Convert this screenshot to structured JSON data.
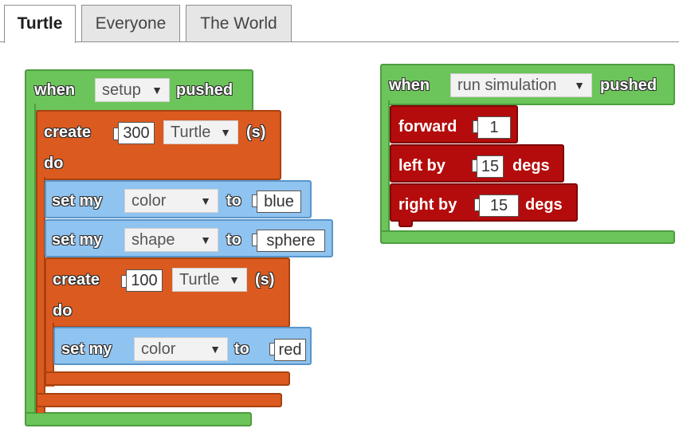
{
  "tabs": [
    {
      "label": "Turtle",
      "active": true
    },
    {
      "label": "Everyone",
      "active": false
    },
    {
      "label": "The World",
      "active": false
    }
  ],
  "colors": {
    "event_green": "#6cc55a",
    "create_orange": "#db5a20",
    "property_blue": "#8fc3f0",
    "motion_red": "#b40c0c"
  },
  "setup_script": {
    "when_label": "when",
    "event_value": "setup",
    "pushed_label": "pushed",
    "create1": {
      "create_label": "create",
      "count": "300",
      "breed": "Turtle",
      "suffix": "(s)",
      "do_label": "do",
      "set1": {
        "label": "set my",
        "property": "color",
        "to_label": "to",
        "value": "blue"
      },
      "set2": {
        "label": "set my",
        "property": "shape",
        "to_label": "to",
        "value": "sphere"
      },
      "create2": {
        "create_label": "create",
        "count": "100",
        "breed": "Turtle",
        "suffix": "(s)",
        "do_label": "do",
        "set1": {
          "label": "set my",
          "property": "color",
          "to_label": "to",
          "value": "red"
        }
      }
    }
  },
  "simulation_script": {
    "when_label": "when",
    "event_value": "run simulation",
    "pushed_label": "pushed",
    "forward": {
      "label": "forward",
      "value": "1"
    },
    "left": {
      "label": "left by",
      "value": "15",
      "unit": "degs"
    },
    "right": {
      "label": "right by",
      "value": "15",
      "unit": "degs"
    }
  }
}
